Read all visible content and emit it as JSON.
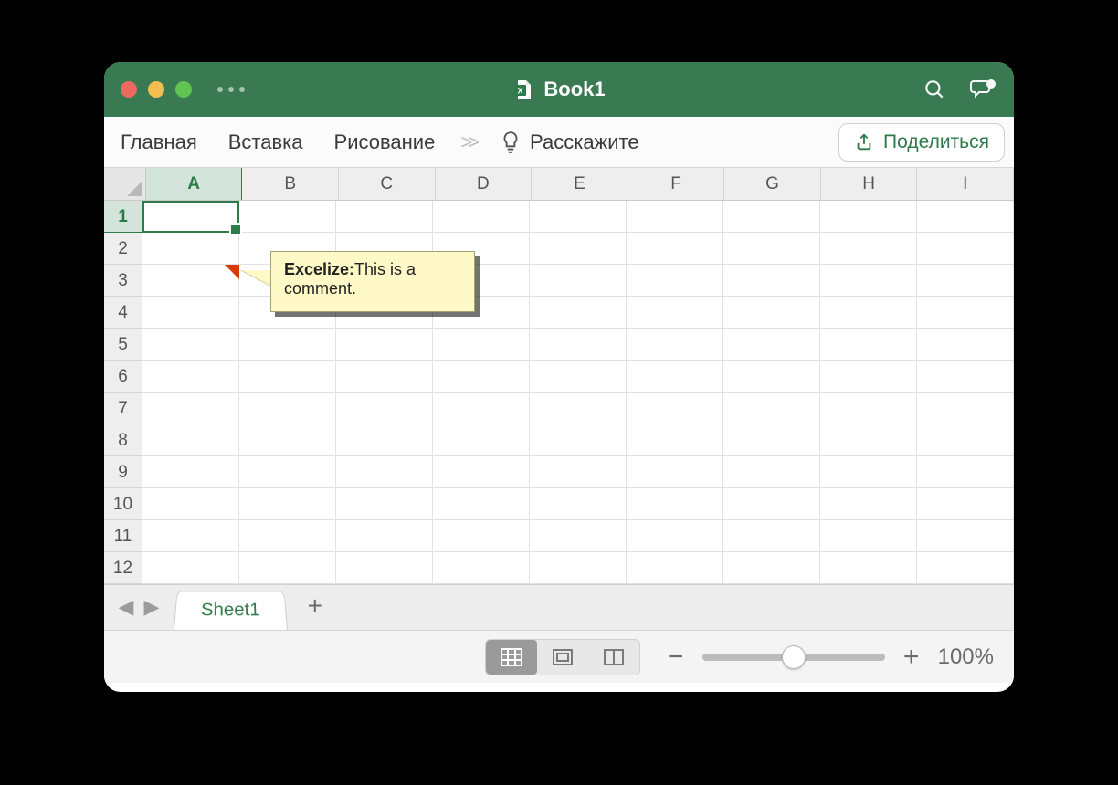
{
  "window": {
    "title": "Book1"
  },
  "ribbon": {
    "tabs": [
      "Главная",
      "Вставка",
      "Рисование"
    ],
    "tell_me": "Расскажите",
    "share": "Поделиться"
  },
  "grid": {
    "columns": [
      "A",
      "B",
      "C",
      "D",
      "E",
      "F",
      "G",
      "H",
      "I"
    ],
    "rows": [
      "1",
      "2",
      "3",
      "4",
      "5",
      "6",
      "7",
      "8",
      "9",
      "10",
      "11",
      "12"
    ],
    "selected_cell": "A1",
    "comment": {
      "cell": "A3",
      "author": "Excelize:",
      "text": "This is a comment."
    }
  },
  "sheets": {
    "active": "Sheet1"
  },
  "status": {
    "zoom": "100%"
  },
  "colors": {
    "brand": "#3a7a52",
    "accent": "#2f7a4a",
    "comment_bg": "#fff9c8"
  }
}
